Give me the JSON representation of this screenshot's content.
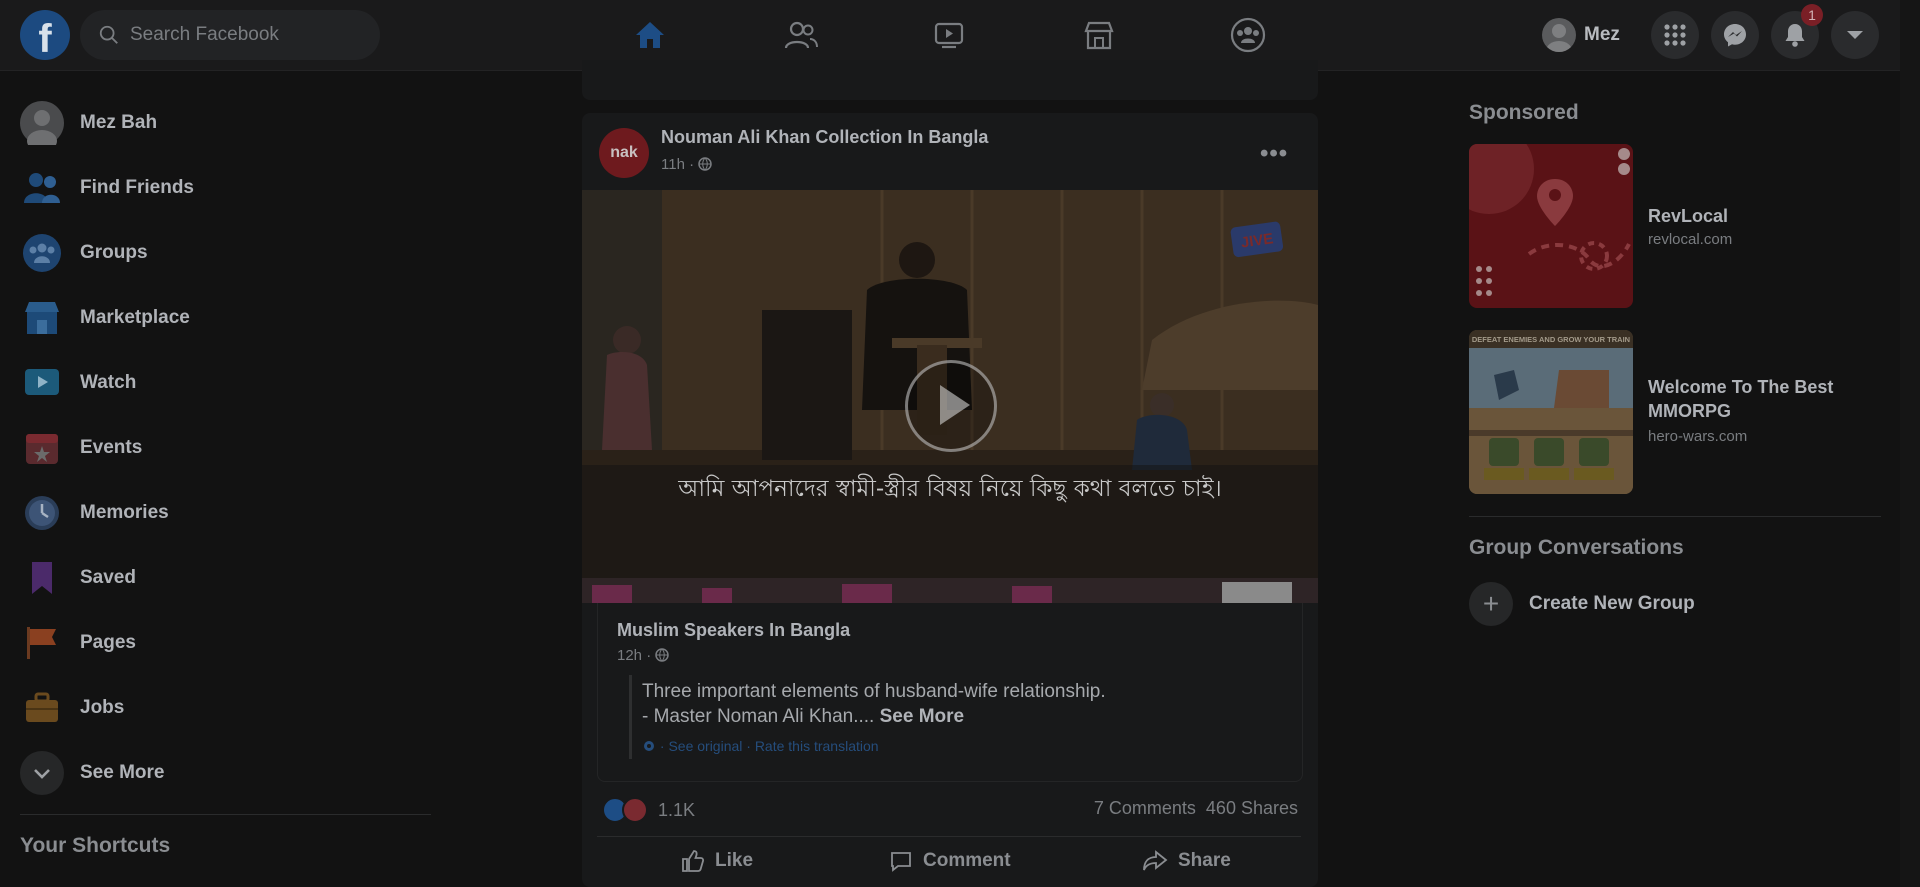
{
  "topbar": {
    "logo": "f",
    "search_placeholder": "Search Facebook",
    "nav_tabs": [
      {
        "name": "home-icon",
        "active": true
      },
      {
        "name": "friends-icon",
        "active": false
      },
      {
        "name": "watch-icon",
        "active": false
      },
      {
        "name": "marketplace-icon",
        "active": false
      },
      {
        "name": "groups-icon",
        "active": false
      }
    ],
    "profile_name": "Mez",
    "notification_count": "1",
    "accent_color": "#1d4d85"
  },
  "left_nav": {
    "profile_name": "Mez Bah",
    "items": [
      {
        "label": "Find Friends",
        "icon": "friends-icon"
      },
      {
        "label": "Groups",
        "icon": "groups-icon"
      },
      {
        "label": "Marketplace",
        "icon": "marketplace-icon"
      },
      {
        "label": "Watch",
        "icon": "watch-icon"
      },
      {
        "label": "Events",
        "icon": "calendar-icon"
      },
      {
        "label": "Memories",
        "icon": "clock-icon"
      },
      {
        "label": "Saved",
        "icon": "bookmark-icon"
      },
      {
        "label": "Pages",
        "icon": "flag-icon"
      },
      {
        "label": "Jobs",
        "icon": "briefcase-icon"
      },
      {
        "label": "See More",
        "icon": "chevron-down-icon"
      }
    ],
    "shortcuts_heading": "Your Shortcuts"
  },
  "post": {
    "page_name": "Nouman Ali Khan Collection In Bangla",
    "avatar_text": "nak",
    "time": "11h ·",
    "video_subtitle": "আমি আপনাদের স্বামী-স্ত্রীর বিষয় নিয়ে কিছু কথা বলতে চাই।",
    "video_logo": "JIVE",
    "shared": {
      "page_name": "Muslim Speakers In Bangla",
      "time": "12h ·",
      "text_line1": "Three important elements of husband-wife relationship.",
      "text_line2": "- Master Noman Ali Khan....",
      "see_more": "See More",
      "translation": "· See original · Rate this translation"
    },
    "reaction_count": "1.1K",
    "comments": "7 Comments",
    "shares": "460 Shares",
    "actions": {
      "like": "Like",
      "comment": "Comment",
      "share": "Share"
    }
  },
  "right_rail": {
    "sponsored_heading": "Sponsored",
    "ads": [
      {
        "title": "RevLocal",
        "url": "revlocal.com"
      },
      {
        "title": "Welcome To The Best MMORPG",
        "url": "hero-wars.com",
        "image_caption": "DEFEAT ENEMIES AND GROW YOUR TRAIN"
      }
    ],
    "group_conversations_heading": "Group Conversations",
    "create_group_label": "Create New Group"
  }
}
